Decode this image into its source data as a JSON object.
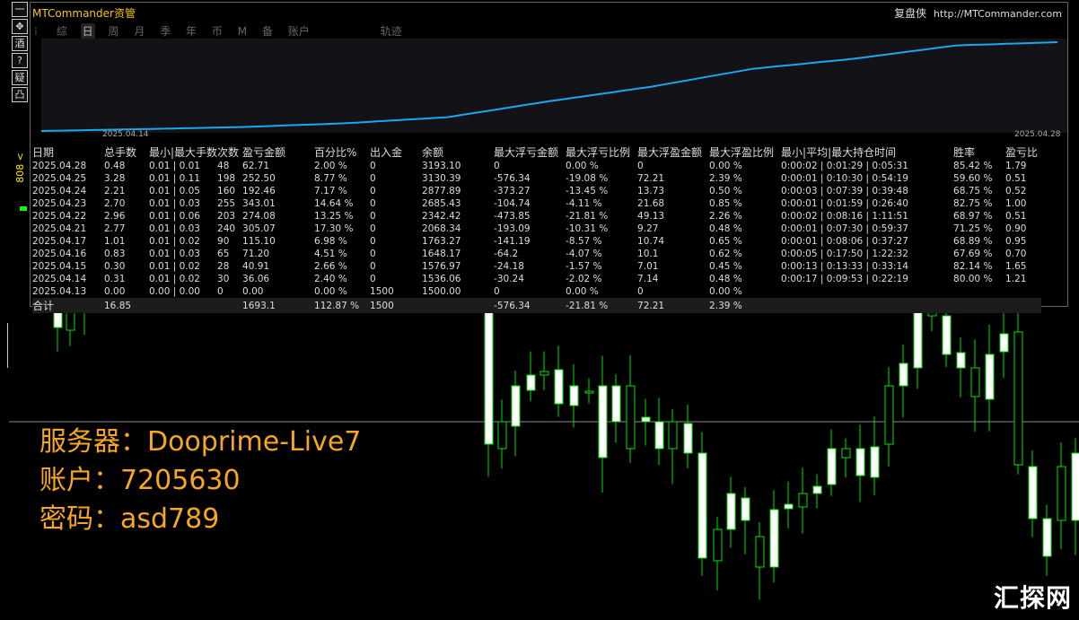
{
  "panel": {
    "title": "MTCommander资管",
    "brand": "复盘侠",
    "url": "http://MTCommander.com",
    "tabs": [
      "综",
      "日",
      "周",
      "月",
      "季",
      "年",
      "币",
      "M",
      "备",
      "账户",
      "轨迹"
    ],
    "active_tab": "日",
    "date_start": "2025.04.14",
    "date_end": "2025.04.28"
  },
  "toolbar": {
    "buttons": [
      "一",
      "✥",
      "酒",
      "?",
      "疑",
      "凸"
    ]
  },
  "price_tag": "808 <",
  "table": {
    "headers": [
      "日期",
      "总手数",
      "最小|最大手数",
      "次数",
      "盈亏金额",
      "百分比%",
      "出入金",
      "余额",
      "最大浮亏金额",
      "最大浮亏比例",
      "最大浮盈金额",
      "最大浮盈比例",
      "最小|平均|最大持仓时间",
      "胜率",
      "盈亏比"
    ],
    "rows": [
      [
        "2025.04.28",
        "0.48",
        "0.01 | 0.01",
        "48",
        "62.71",
        "2.00 %",
        "0",
        "3193.10",
        "0",
        "0.00 %",
        "0",
        "0.00 %",
        "0:00:02 | 0:01:29 | 0:05:31",
        "85.42 %",
        "1.79"
      ],
      [
        "2025.04.25",
        "3.28",
        "0.01 | 0.11",
        "198",
        "252.50",
        "8.77 %",
        "0",
        "3130.39",
        "-576.34",
        "-19.08 %",
        "72.21",
        "2.39 %",
        "0:00:01 | 0:10:30 | 0:54:19",
        "59.60 %",
        "0.51"
      ],
      [
        "2025.04.24",
        "2.21",
        "0.01 | 0.05",
        "160",
        "192.46",
        "7.17 %",
        "0",
        "2877.89",
        "-373.27",
        "-13.45 %",
        "13.73",
        "0.50 %",
        "0:00:03 | 0:07:39 | 0:39:48",
        "68.75 %",
        "0.52"
      ],
      [
        "2025.04.23",
        "2.70",
        "0.01 | 0.03",
        "255",
        "343.01",
        "14.64 %",
        "0",
        "2685.43",
        "-104.74",
        "-4.11 %",
        "21.68",
        "0.85 %",
        "0:00:01 | 0:01:59 | 0:26:40",
        "82.75 %",
        "1.00"
      ],
      [
        "2025.04.22",
        "2.96",
        "0.01 | 0.06",
        "203",
        "274.08",
        "13.25 %",
        "0",
        "2342.42",
        "-473.85",
        "-21.81 %",
        "49.13",
        "2.26 %",
        "0:00:02 | 0:08:16 | 1:11:51",
        "68.97 %",
        "0.51"
      ],
      [
        "2025.04.21",
        "2.77",
        "0.01 | 0.03",
        "240",
        "305.07",
        "17.30 %",
        "0",
        "2068.34",
        "-193.09",
        "-10.31 %",
        "9.27",
        "0.48 %",
        "0:00:01 | 0:07:30 | 0:59:37",
        "71.25 %",
        "0.90"
      ],
      [
        "2025.04.17",
        "1.01",
        "0.01 | 0.02",
        "90",
        "115.10",
        "6.98 %",
        "0",
        "1763.27",
        "-141.19",
        "-8.57 %",
        "10.74",
        "0.65 %",
        "0:00:01 | 0:08:06 | 0:37:27",
        "68.89 %",
        "0.95"
      ],
      [
        "2025.04.16",
        "0.83",
        "0.01 | 0.03",
        "65",
        "71.20",
        "4.51 %",
        "0",
        "1648.17",
        "-64.2",
        "-4.07 %",
        "10.1",
        "0.62 %",
        "0:00:05 | 0:17:50 | 1:22:32",
        "67.69 %",
        "0.70"
      ],
      [
        "2025.04.15",
        "0.30",
        "0.01 | 0.02",
        "28",
        "40.91",
        "2.66 %",
        "0",
        "1576.97",
        "-24.18",
        "-1.57 %",
        "7.01",
        "0.45 %",
        "0:00:13 | 0:13:33 | 0:33:14",
        "82.14 %",
        "1.65"
      ],
      [
        "2025.04.14",
        "0.31",
        "0.01 | 0.02",
        "30",
        "36.06",
        "2.40 %",
        "0",
        "1536.06",
        "-30.24",
        "-2.02 %",
        "7.14",
        "0.48 %",
        "0:00:17 | 0:09:53 | 0:22:19",
        "80.00 %",
        "1.21"
      ],
      [
        "2025.04.13",
        "0.00",
        "0.00 | 0.00",
        "0",
        "0.00",
        "0.00 %",
        "1500",
        "1500.00",
        "0",
        "0.00 %",
        "0",
        "0.00 %",
        "",
        "",
        ""
      ]
    ],
    "total": [
      "合计",
      "16.85",
      "",
      "",
      "1693.1",
      "112.87 %",
      "1500",
      "",
      "-576.34",
      "-21.81 %",
      "72.21",
      "2.39 %",
      "",
      "",
      ""
    ]
  },
  "equity_series": {
    "dates": [
      "2025.04.13",
      "2025.04.14",
      "2025.04.15",
      "2025.04.16",
      "2025.04.17",
      "2025.04.21",
      "2025.04.22",
      "2025.04.23",
      "2025.04.24",
      "2025.04.25",
      "2025.04.28"
    ],
    "balance": [
      1500.0,
      1536.06,
      1576.97,
      1648.17,
      1763.27,
      2068.34,
      2342.42,
      2685.43,
      2877.89,
      3130.39,
      3193.1
    ]
  },
  "info": {
    "server": "服务器：Dooprime-Live7",
    "account": "账户：7205630",
    "password": "密码：asd789"
  },
  "watermark": "汇探网",
  "colors": {
    "accent": "#f5a623",
    "negative": "#e8202a",
    "drawdown": "#4fd4ff",
    "equity_line": "#1ba8f0",
    "candle_up": "#ffffff",
    "candle_wick": "#00e000"
  }
}
